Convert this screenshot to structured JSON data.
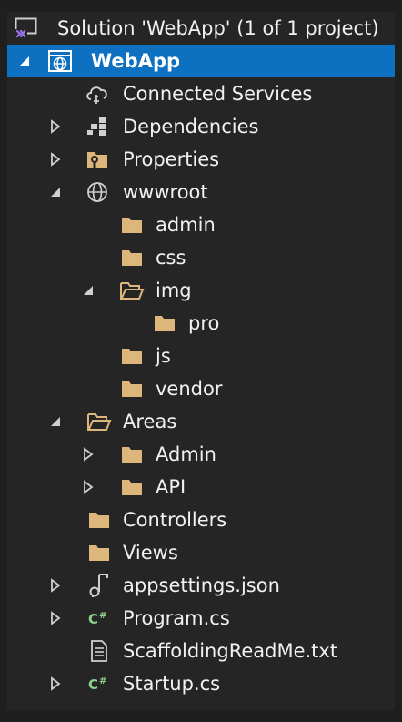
{
  "solution_explorer": {
    "solution_label": "Solution 'WebApp' (1 of 1 project)",
    "project": "WebApp",
    "items": {
      "connected_services": "Connected Services",
      "dependencies": "Dependencies",
      "properties": "Properties",
      "wwwroot": "wwwroot",
      "admin": "admin",
      "css": "css",
      "img": "img",
      "pro": "pro",
      "js": "js",
      "vendor": "vendor",
      "areas": "Areas",
      "areas_admin": "Admin",
      "api": "API",
      "controllers": "Controllers",
      "views": "Views",
      "appsettings": "appsettings.json",
      "program": "Program.cs",
      "scaffolding_readme": "ScaffoldingReadMe.txt",
      "startup": "Startup.cs"
    }
  },
  "colors": {
    "background": "#252526",
    "selection": "#0e70c0",
    "folder": "#dcb67a",
    "csharp": "#8cd08c",
    "text": "#f1f1f1"
  }
}
